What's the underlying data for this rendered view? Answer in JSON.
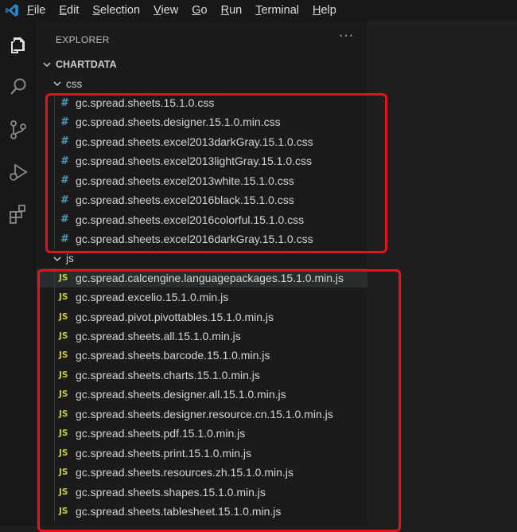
{
  "menu": [
    "File",
    "Edit",
    "Selection",
    "View",
    "Go",
    "Run",
    "Terminal",
    "Help"
  ],
  "explorer": {
    "title": "EXPLORER",
    "more": "···",
    "root": "CHARTDATA",
    "folders": [
      {
        "name": "css",
        "icon": "css-file-icon",
        "files": [
          "gc.spread.sheets.15.1.0.css",
          "gc.spread.sheets.designer.15.1.0.min.css",
          "gc.spread.sheets.excel2013darkGray.15.1.0.css",
          "gc.spread.sheets.excel2013lightGray.15.1.0.css",
          "gc.spread.sheets.excel2013white.15.1.0.css",
          "gc.spread.sheets.excel2016black.15.1.0.css",
          "gc.spread.sheets.excel2016colorful.15.1.0.css",
          "gc.spread.sheets.excel2016darkGray.15.1.0.css"
        ]
      },
      {
        "name": "js",
        "icon": "js-file-icon",
        "files": [
          "gc.spread.calcengine.languagepackages.15.1.0.min.js",
          "gc.spread.excelio.15.1.0.min.js",
          "gc.spread.pivot.pivottables.15.1.0.min.js",
          "gc.spread.sheets.all.15.1.0.min.js",
          "gc.spread.sheets.barcode.15.1.0.min.js",
          "gc.spread.sheets.charts.15.1.0.min.js",
          "gc.spread.sheets.designer.all.15.1.0.min.js",
          "gc.spread.sheets.designer.resource.cn.15.1.0.min.js",
          "gc.spread.sheets.pdf.15.1.0.min.js",
          "gc.spread.sheets.print.15.1.0.min.js",
          "gc.spread.sheets.resources.zh.15.1.0.min.js",
          "gc.spread.sheets.shapes.15.1.0.min.js",
          "gc.spread.sheets.tablesheet.15.1.0.min.js"
        ]
      }
    ],
    "css_icon_glyph": "#",
    "js_icon_glyph": "JS",
    "selected_file": "gc.spread.calcengine.languagepackages.15.1.0.min.js"
  },
  "colors": {
    "highlight": "#e8111b",
    "css_icon": "#519aba",
    "js_icon": "#cbcb41",
    "vscode_logo": "#2489ca"
  }
}
